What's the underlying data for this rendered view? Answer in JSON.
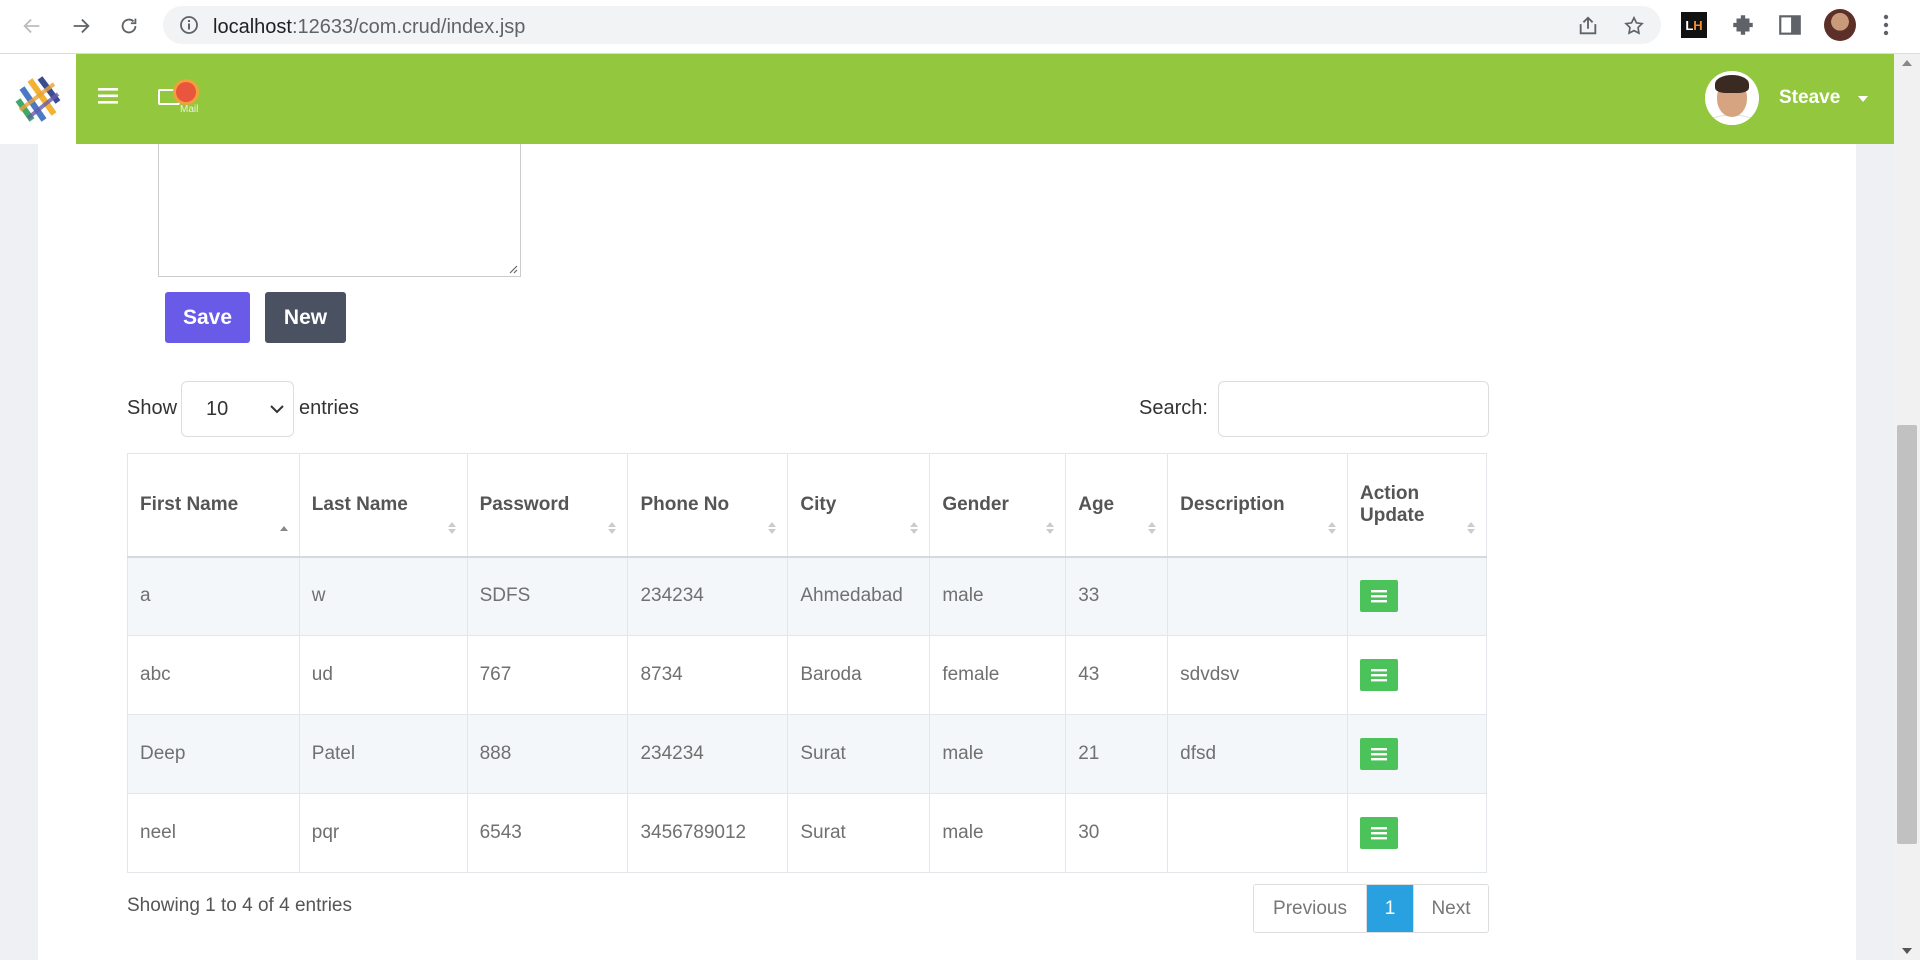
{
  "browser": {
    "url_host": "localhost",
    "url_path": ":12633/com.crud/index.jsp",
    "extension_badge": [
      "L",
      "H"
    ]
  },
  "header": {
    "mail_logo_text": "Mail",
    "user_name": "Steave",
    "brand_color": "#93c83e"
  },
  "form": {
    "save_label": "Save",
    "new_label": "New"
  },
  "table_controls": {
    "show_label": "Show",
    "entries_value": "10",
    "entries_label": "entries",
    "search_label": "Search:",
    "search_value": ""
  },
  "table": {
    "columns": [
      "First Name",
      "Last Name",
      "Password",
      "Phone No",
      "City",
      "Gender",
      "Age",
      "Description",
      "Action Update"
    ],
    "rows": [
      [
        "a",
        "w",
        "SDFS",
        "234234",
        "Ahmedabad",
        "male",
        "33",
        ""
      ],
      [
        "abc",
        "ud",
        "767",
        "8734",
        "Baroda",
        "female",
        "43",
        "sdvdsv"
      ],
      [
        "Deep",
        "Patel",
        "888",
        "234234",
        "Surat",
        "male",
        "21",
        "dfsd"
      ],
      [
        "neel",
        "pqr",
        "6543",
        "3456789012",
        "Surat",
        "male",
        "30",
        ""
      ]
    ],
    "info": "Showing 1 to 4 of 4 entries"
  },
  "pagination": {
    "previous": "Previous",
    "current": "1",
    "next": "Next"
  }
}
